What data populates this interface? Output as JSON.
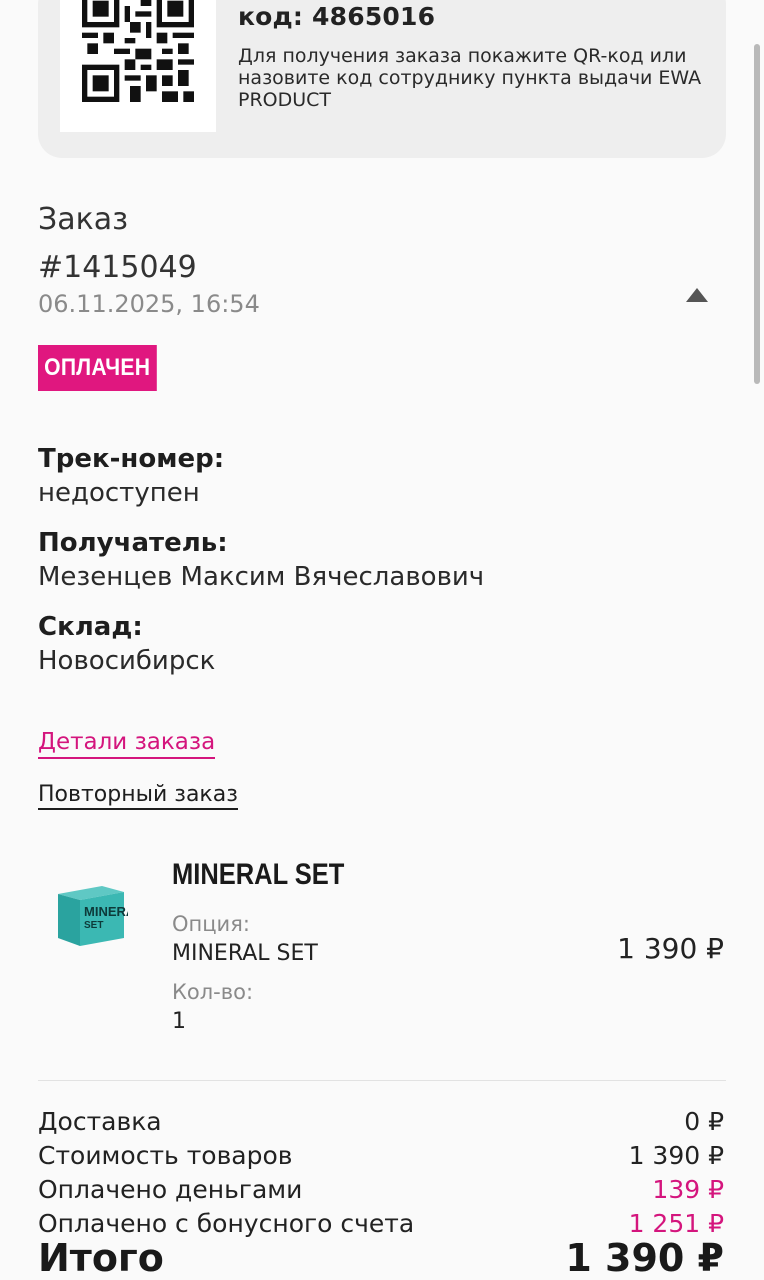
{
  "pickup": {
    "code_text": "код: 4865016",
    "note": "Для получения заказа покажите QR-код или назовите код сотруднику пункта выдачи EWA PRODUCT"
  },
  "order": {
    "label": "Заказ",
    "number": "#1415049",
    "date": "06.11.2025, 16:54",
    "status": "ОПЛАЧЕН",
    "toggle_icon": "triangle-up-icon"
  },
  "details": {
    "track_label": "Трек-номер:",
    "track_value": "недоступен",
    "recipient_label": "Получатель:",
    "recipient_value": "Мезенцев Максим Вячеславович",
    "warehouse_label": "Склад:",
    "warehouse_value": "Новосибирск"
  },
  "links": {
    "details": "Детали заказа",
    "repeat": "Повторный заказ"
  },
  "product": {
    "name": "MINERAL SET",
    "option_label": "Опция:",
    "option_value": "MINERAL SET",
    "qty_label": "Кол-во:",
    "qty_value": "1",
    "price": "1 390 ₽",
    "box_text_line1": "MINERAL",
    "box_text_line2": "SET"
  },
  "summary": {
    "delivery_label": "Доставка",
    "delivery_value": "0 ₽",
    "goods_label": "Стоимость товаров",
    "goods_value": "1 390 ₽",
    "paid_money_label": "Оплачено деньгами",
    "paid_money_value": "139 ₽",
    "paid_bonus_label": "Оплачено с бонусного счета",
    "paid_bonus_value": "1 251 ₽",
    "total_label": "Итого",
    "total_value": "1 390 ₽"
  },
  "colors": {
    "accent": "#d4157d",
    "badge": "#e0177f",
    "card_bg": "#eeeeee"
  }
}
